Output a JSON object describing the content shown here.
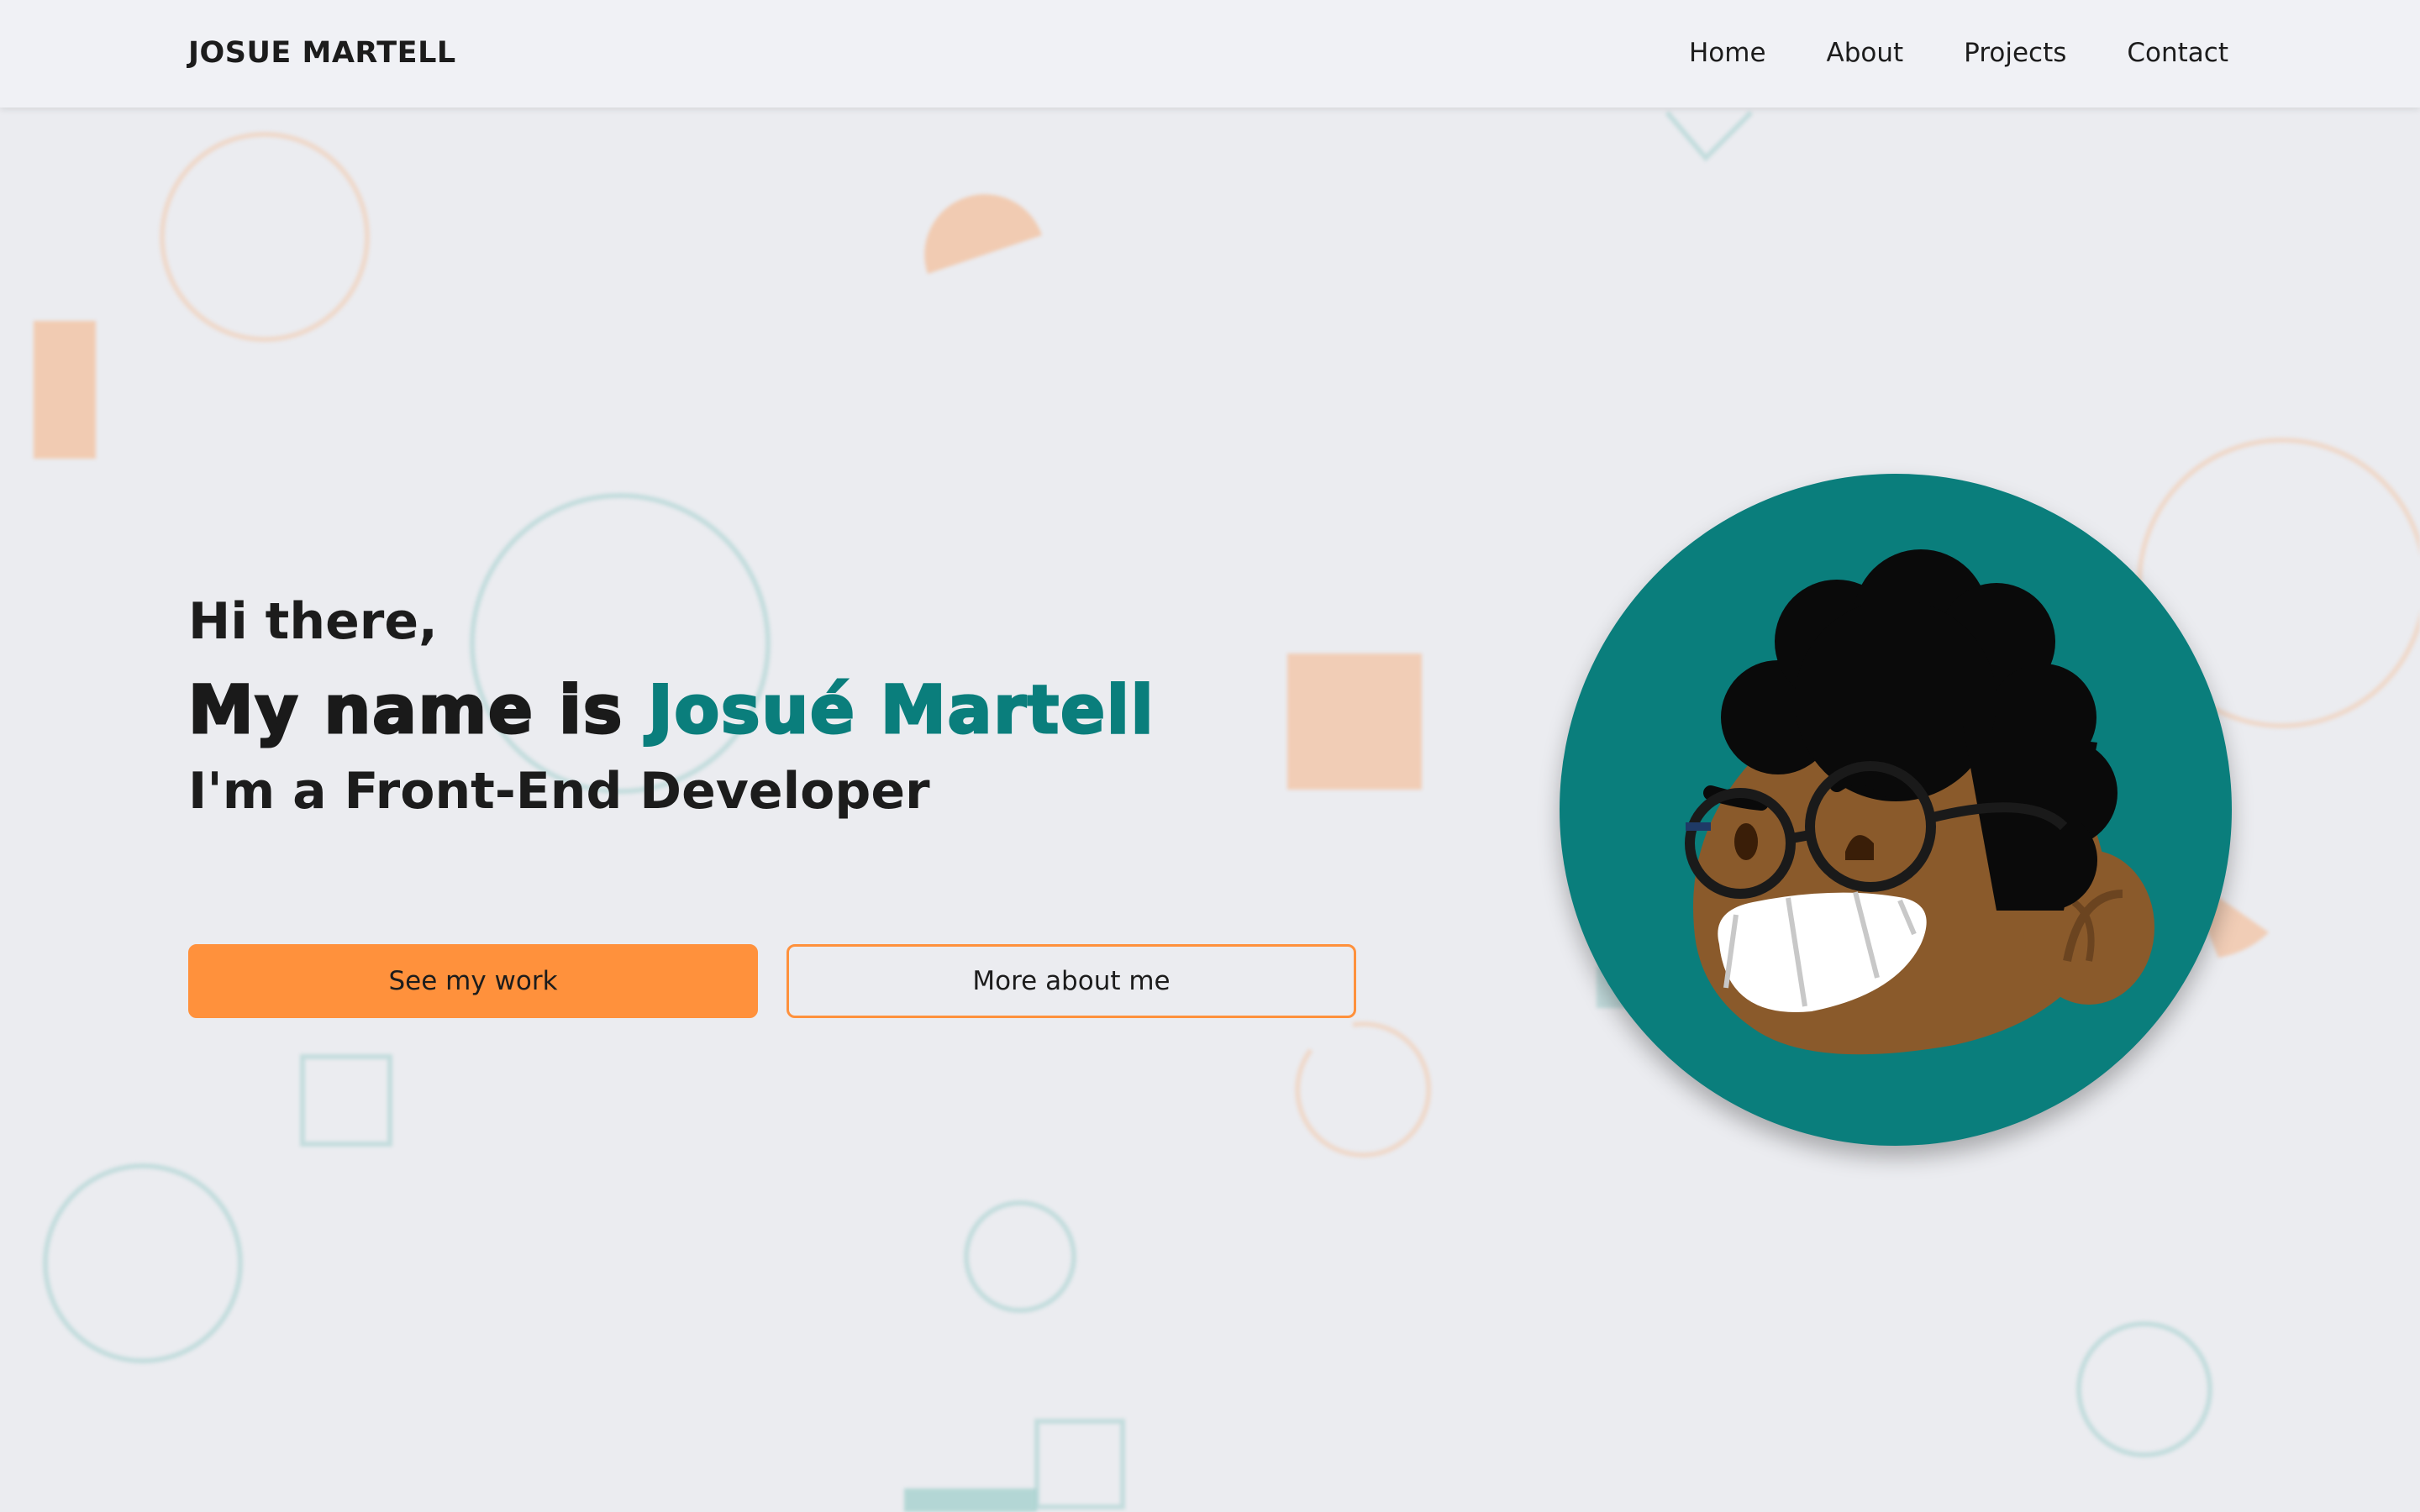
{
  "nav": {
    "brand": "JOSUE MARTELL",
    "links": [
      "Home",
      "About",
      "Projects",
      "Contact"
    ]
  },
  "hero": {
    "greeting": "Hi there,",
    "name_prefix": "My name is ",
    "name": "Josué Martell",
    "role": "I'm a Front-End Developer",
    "primary_button": "See my work",
    "secondary_button": "More about me"
  },
  "colors": {
    "accent_teal": "#0a7e7c",
    "accent_orange": "#ff913c",
    "background": "#ebecf0",
    "navbar": "#f0f1f5",
    "text": "#1c1c1c"
  },
  "icons": {
    "avatar": "cartoon-developer-portrait"
  }
}
